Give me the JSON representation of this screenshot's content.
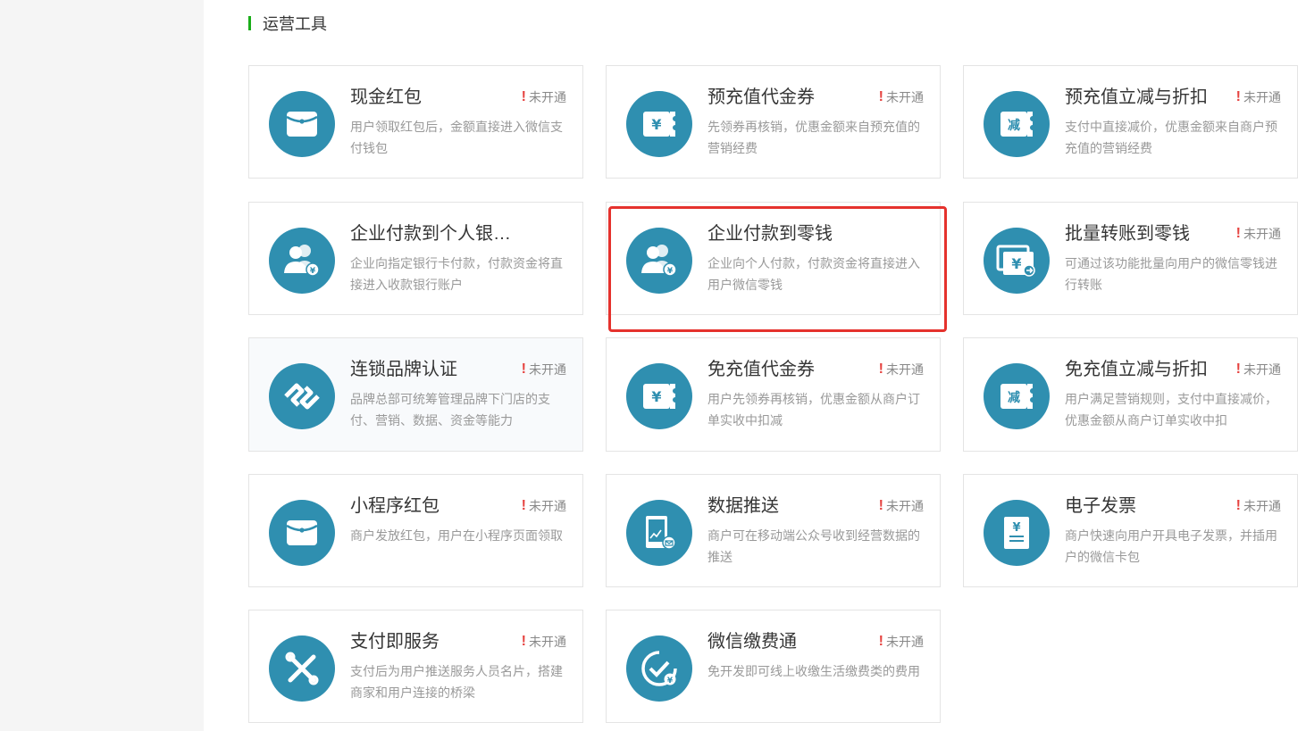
{
  "section": {
    "title": "运营工具"
  },
  "status_text": "未开通",
  "status_mark": "!",
  "colors": {
    "accent_green": "#1aad19",
    "icon_teal": "#2f8fb0",
    "warning_red": "#e64340",
    "highlight_red": "#e5322d"
  },
  "tools": [
    {
      "title": "现金红包",
      "desc": "用户领取红包后，金额直接进入微信支付钱包",
      "icon": "red-envelope-icon",
      "status": true
    },
    {
      "title": "预充值代金券",
      "desc": "先领券再核销，优惠金额来自预充值的营销经费",
      "icon": "yen-coupon-icon",
      "status": true
    },
    {
      "title": "预充值立减与折扣",
      "desc": "支付中直接减价，优惠金额来自商户预充值的营销经费",
      "icon": "discount-coupon-icon",
      "status": true
    },
    {
      "title": "企业付款到个人银…",
      "desc": "企业向指定银行卡付款，付款资金将直接进入收款银行账户",
      "icon": "users-payment-icon",
      "status": false
    },
    {
      "title": "企业付款到零钱",
      "desc": "企业向个人付款，付款资金将直接进入用户微信零钱",
      "icon": "users-payment-icon",
      "status": false
    },
    {
      "title": "批量转账到零钱",
      "desc": "可通过该功能批量向用户的微信零钱进行转账",
      "icon": "batch-transfer-icon",
      "status": true
    },
    {
      "title": "连锁品牌认证",
      "desc": "品牌总部可统筹管理品牌下门店的支付、营销、数据、资金等能力",
      "icon": "chain-link-icon",
      "status": true
    },
    {
      "title": "免充值代金券",
      "desc": "用户先领券再核销，优惠金额从商户订单实收中扣减",
      "icon": "yen-coupon-icon",
      "status": true
    },
    {
      "title": "免充值立减与折扣",
      "desc": "用户满足营销规则，支付中直接减价，优惠金额从商户订单实收中扣",
      "icon": "discount-coupon-icon",
      "status": true
    },
    {
      "title": "小程序红包",
      "desc": "商户发放红包，用户在小程序页面领取",
      "icon": "red-envelope-icon",
      "status": true
    },
    {
      "title": "数据推送",
      "desc": "商户可在移动端公众号收到经营数据的推送",
      "icon": "data-push-icon",
      "status": true
    },
    {
      "title": "电子发票",
      "desc": "商户快速向用户开具电子发票，并插用户的微信卡包",
      "icon": "invoice-icon",
      "status": true
    },
    {
      "title": "支付即服务",
      "desc": "支付后为用户推送服务人员名片，搭建商家和用户连接的桥梁",
      "icon": "service-link-icon",
      "status": true
    },
    {
      "title": "微信缴费通",
      "desc": "免开发即可线上收缴生活缴费类的费用",
      "icon": "bill-payment-icon",
      "status": true
    }
  ]
}
